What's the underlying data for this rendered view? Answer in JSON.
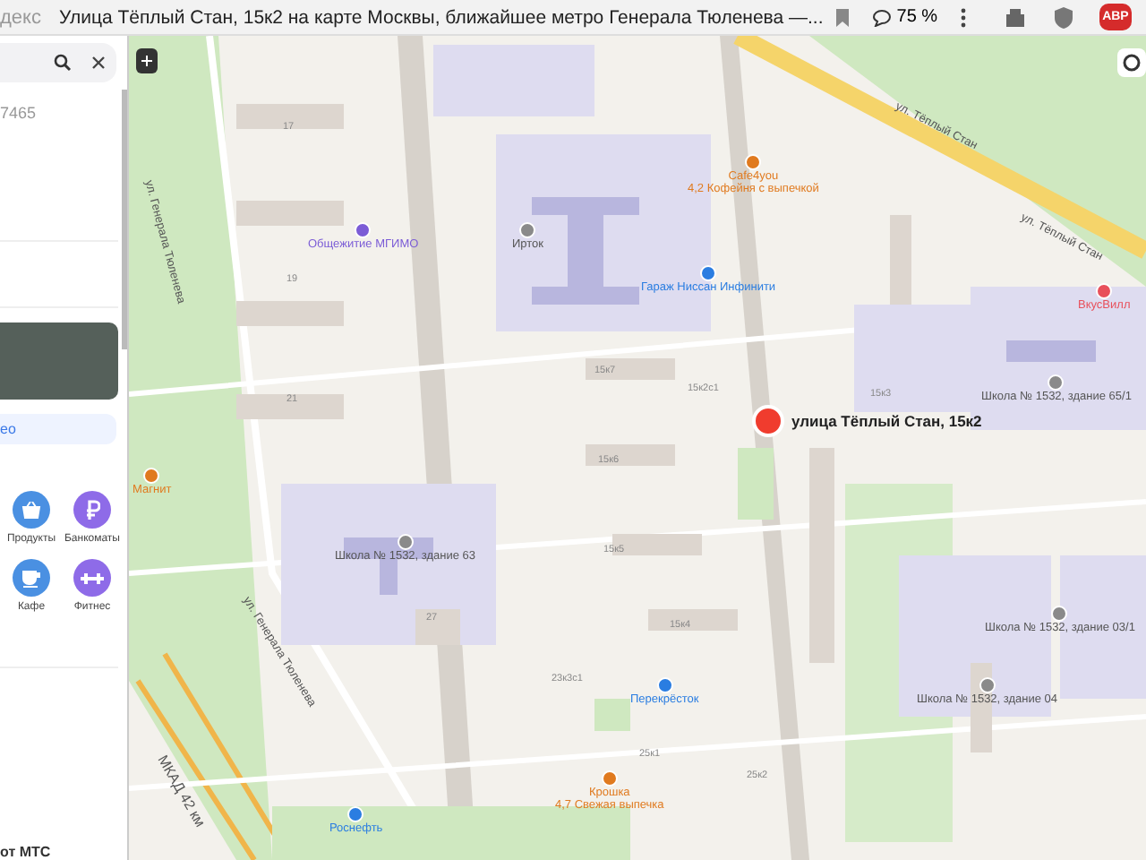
{
  "browser": {
    "tab_fragment": "декс",
    "title": "Улица Тёплый Стан, 15к2 на карте Москвы, ближайшее метро Генерала Тюленева —...",
    "zoom": "75 %",
    "adblock": "ABP"
  },
  "sidebar": {
    "detail_fragment": "7465",
    "link_fragment": "ео",
    "footer_fragment": "от МТС",
    "categories": [
      {
        "label": "Продукты",
        "kind": "basket",
        "color": "#4a90e2"
      },
      {
        "label": "Банкоматы",
        "kind": "ruble",
        "color": "#8e6be8"
      },
      {
        "label": "Кафе",
        "kind": "cup",
        "color": "#4a90e2"
      },
      {
        "label": "Фитнес",
        "kind": "dumbbell",
        "color": "#8e6be8"
      }
    ]
  },
  "map": {
    "labels": [
      {
        "kind": "street",
        "text": "ул. Тёплый Стан"
      },
      {
        "kind": "street",
        "text": "ул. Тёплый Стан"
      },
      {
        "kind": "street",
        "text": "ул. Генерала Тюленева"
      },
      {
        "kind": "street",
        "text": "ул. Генерала Тюленева"
      },
      {
        "kind": "road",
        "text": "МКАД 42 км"
      },
      {
        "kind": "poi",
        "text": "Общежитие МГИМО",
        "color": "#7b5cd6"
      },
      {
        "kind": "poi",
        "text": "Cafe4you",
        "subtitle": "4,2 Кофейня с выпечкой",
        "color": "#e07a1f"
      },
      {
        "kind": "poi",
        "text": "Гараж Ниссан Инфинити",
        "color": "#2a7de1"
      },
      {
        "kind": "poi",
        "text": "Ирток",
        "color": "#8a8a8a"
      },
      {
        "kind": "pin",
        "text": "улица Тёплый Стан, 15к2",
        "color": "#f03c2e"
      },
      {
        "kind": "poi",
        "text": "Школа № 1532, здание 63",
        "color": "#8a8a8a"
      },
      {
        "kind": "poi",
        "text": "Школа № 1532, здание 65/1",
        "color": "#8a8a8a"
      },
      {
        "kind": "poi",
        "text": "Школа № 1532, здание 04",
        "color": "#8a8a8a"
      },
      {
        "kind": "poi",
        "text": "Школа № 1532, здание 03/1",
        "color": "#8a8a8a"
      },
      {
        "kind": "poi",
        "text": "Перекрёсток",
        "color": "#2a7de1"
      },
      {
        "kind": "poi",
        "text": "Крошка",
        "subtitle": "4,7 Свежая выпечка",
        "color": "#e07a1f"
      },
      {
        "kind": "poi",
        "text": "Роснефть",
        "color": "#2a7de1"
      },
      {
        "kind": "poi",
        "text": "ВкусВилл",
        "color": "#e8505b"
      },
      {
        "kind": "poi",
        "text": "Магнит",
        "color": "#e07a1f"
      },
      {
        "kind": "house",
        "text": "17"
      },
      {
        "kind": "house",
        "text": "19"
      },
      {
        "kind": "house",
        "text": "21"
      },
      {
        "kind": "house",
        "text": "15к7"
      },
      {
        "kind": "house",
        "text": "15к2с1"
      },
      {
        "kind": "house",
        "text": "15к3"
      },
      {
        "kind": "house",
        "text": "15к6"
      },
      {
        "kind": "house",
        "text": "15к5"
      },
      {
        "kind": "house",
        "text": "15к4"
      },
      {
        "kind": "house",
        "text": "27"
      },
      {
        "kind": "house",
        "text": "23к3с1"
      },
      {
        "kind": "house",
        "text": "25к1"
      },
      {
        "kind": "house",
        "text": "25к2"
      }
    ]
  }
}
